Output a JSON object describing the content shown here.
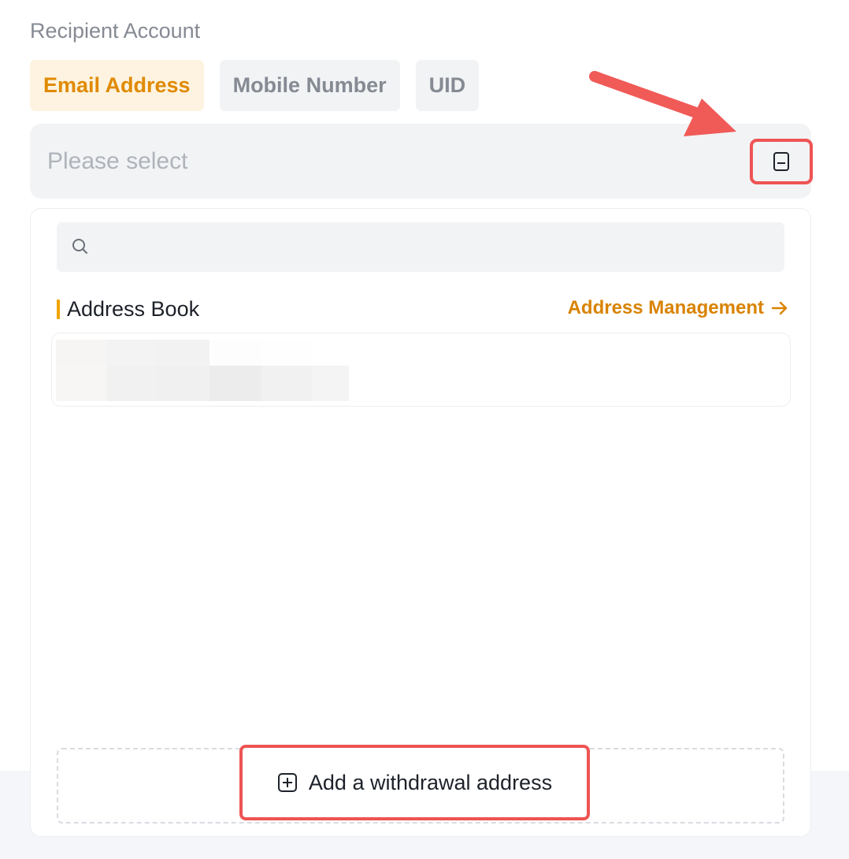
{
  "recipient": {
    "label": "Recipient Account",
    "tabs": [
      {
        "label": "Email Address",
        "active": true
      },
      {
        "label": "Mobile Number",
        "active": false
      },
      {
        "label": "UID",
        "active": false
      }
    ]
  },
  "select": {
    "placeholder": "Please select",
    "address_book_button_icon": "address-book-icon"
  },
  "dropdown": {
    "search": {
      "placeholder": "",
      "value": "",
      "icon": "search-icon"
    },
    "address_book": {
      "title": "Address Book",
      "management_link": "Address Management",
      "management_icon": "arrow-right-icon"
    },
    "add_button": {
      "label": "Add a withdrawal address",
      "icon": "plus-square-icon"
    }
  },
  "colors": {
    "accent": "#e08a00",
    "accent_bg": "#fdf3e0",
    "highlight": "#ee5454",
    "muted_text": "#858a93",
    "field_bg": "#f2f3f5"
  }
}
